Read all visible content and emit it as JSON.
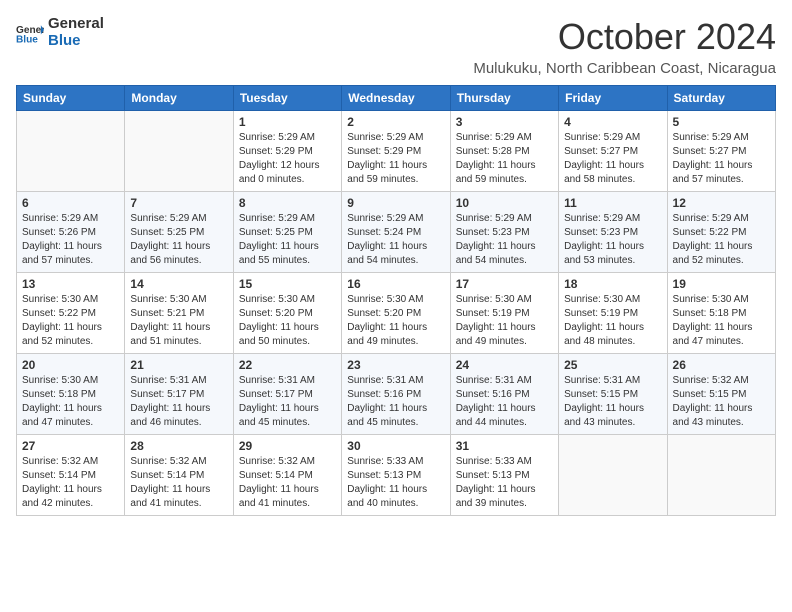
{
  "logo": {
    "text_general": "General",
    "text_blue": "Blue"
  },
  "title": "October 2024",
  "location": "Mulukuku, North Caribbean Coast, Nicaragua",
  "headers": [
    "Sunday",
    "Monday",
    "Tuesday",
    "Wednesday",
    "Thursday",
    "Friday",
    "Saturday"
  ],
  "weeks": [
    [
      {
        "day": "",
        "detail": ""
      },
      {
        "day": "",
        "detail": ""
      },
      {
        "day": "1",
        "detail": "Sunrise: 5:29 AM\nSunset: 5:29 PM\nDaylight: 12 hours and 0 minutes."
      },
      {
        "day": "2",
        "detail": "Sunrise: 5:29 AM\nSunset: 5:29 PM\nDaylight: 11 hours and 59 minutes."
      },
      {
        "day": "3",
        "detail": "Sunrise: 5:29 AM\nSunset: 5:28 PM\nDaylight: 11 hours and 59 minutes."
      },
      {
        "day": "4",
        "detail": "Sunrise: 5:29 AM\nSunset: 5:27 PM\nDaylight: 11 hours and 58 minutes."
      },
      {
        "day": "5",
        "detail": "Sunrise: 5:29 AM\nSunset: 5:27 PM\nDaylight: 11 hours and 57 minutes."
      }
    ],
    [
      {
        "day": "6",
        "detail": "Sunrise: 5:29 AM\nSunset: 5:26 PM\nDaylight: 11 hours and 57 minutes."
      },
      {
        "day": "7",
        "detail": "Sunrise: 5:29 AM\nSunset: 5:25 PM\nDaylight: 11 hours and 56 minutes."
      },
      {
        "day": "8",
        "detail": "Sunrise: 5:29 AM\nSunset: 5:25 PM\nDaylight: 11 hours and 55 minutes."
      },
      {
        "day": "9",
        "detail": "Sunrise: 5:29 AM\nSunset: 5:24 PM\nDaylight: 11 hours and 54 minutes."
      },
      {
        "day": "10",
        "detail": "Sunrise: 5:29 AM\nSunset: 5:23 PM\nDaylight: 11 hours and 54 minutes."
      },
      {
        "day": "11",
        "detail": "Sunrise: 5:29 AM\nSunset: 5:23 PM\nDaylight: 11 hours and 53 minutes."
      },
      {
        "day": "12",
        "detail": "Sunrise: 5:29 AM\nSunset: 5:22 PM\nDaylight: 11 hours and 52 minutes."
      }
    ],
    [
      {
        "day": "13",
        "detail": "Sunrise: 5:30 AM\nSunset: 5:22 PM\nDaylight: 11 hours and 52 minutes."
      },
      {
        "day": "14",
        "detail": "Sunrise: 5:30 AM\nSunset: 5:21 PM\nDaylight: 11 hours and 51 minutes."
      },
      {
        "day": "15",
        "detail": "Sunrise: 5:30 AM\nSunset: 5:20 PM\nDaylight: 11 hours and 50 minutes."
      },
      {
        "day": "16",
        "detail": "Sunrise: 5:30 AM\nSunset: 5:20 PM\nDaylight: 11 hours and 49 minutes."
      },
      {
        "day": "17",
        "detail": "Sunrise: 5:30 AM\nSunset: 5:19 PM\nDaylight: 11 hours and 49 minutes."
      },
      {
        "day": "18",
        "detail": "Sunrise: 5:30 AM\nSunset: 5:19 PM\nDaylight: 11 hours and 48 minutes."
      },
      {
        "day": "19",
        "detail": "Sunrise: 5:30 AM\nSunset: 5:18 PM\nDaylight: 11 hours and 47 minutes."
      }
    ],
    [
      {
        "day": "20",
        "detail": "Sunrise: 5:30 AM\nSunset: 5:18 PM\nDaylight: 11 hours and 47 minutes."
      },
      {
        "day": "21",
        "detail": "Sunrise: 5:31 AM\nSunset: 5:17 PM\nDaylight: 11 hours and 46 minutes."
      },
      {
        "day": "22",
        "detail": "Sunrise: 5:31 AM\nSunset: 5:17 PM\nDaylight: 11 hours and 45 minutes."
      },
      {
        "day": "23",
        "detail": "Sunrise: 5:31 AM\nSunset: 5:16 PM\nDaylight: 11 hours and 45 minutes."
      },
      {
        "day": "24",
        "detail": "Sunrise: 5:31 AM\nSunset: 5:16 PM\nDaylight: 11 hours and 44 minutes."
      },
      {
        "day": "25",
        "detail": "Sunrise: 5:31 AM\nSunset: 5:15 PM\nDaylight: 11 hours and 43 minutes."
      },
      {
        "day": "26",
        "detail": "Sunrise: 5:32 AM\nSunset: 5:15 PM\nDaylight: 11 hours and 43 minutes."
      }
    ],
    [
      {
        "day": "27",
        "detail": "Sunrise: 5:32 AM\nSunset: 5:14 PM\nDaylight: 11 hours and 42 minutes."
      },
      {
        "day": "28",
        "detail": "Sunrise: 5:32 AM\nSunset: 5:14 PM\nDaylight: 11 hours and 41 minutes."
      },
      {
        "day": "29",
        "detail": "Sunrise: 5:32 AM\nSunset: 5:14 PM\nDaylight: 11 hours and 41 minutes."
      },
      {
        "day": "30",
        "detail": "Sunrise: 5:33 AM\nSunset: 5:13 PM\nDaylight: 11 hours and 40 minutes."
      },
      {
        "day": "31",
        "detail": "Sunrise: 5:33 AM\nSunset: 5:13 PM\nDaylight: 11 hours and 39 minutes."
      },
      {
        "day": "",
        "detail": ""
      },
      {
        "day": "",
        "detail": ""
      }
    ]
  ]
}
